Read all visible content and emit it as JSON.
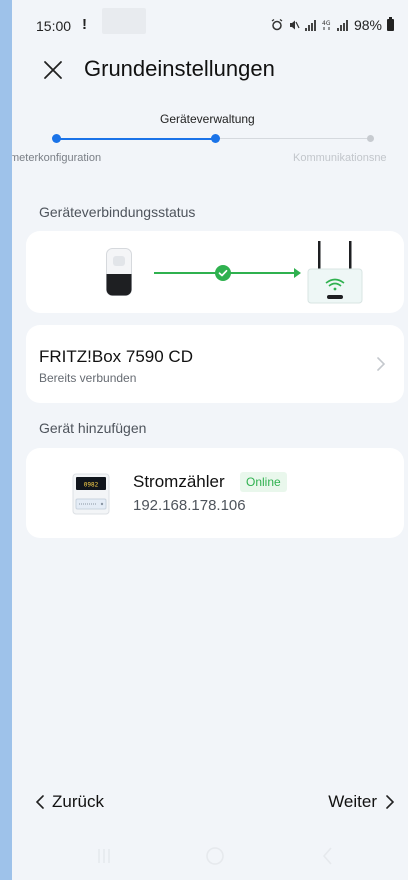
{
  "status_bar": {
    "time": "15:00",
    "alert": "!",
    "battery": "98%"
  },
  "header": {
    "title": "Grundeinstellungen"
  },
  "stepper": {
    "current": "Geräteverwaltung",
    "previous": "meterkonfiguration",
    "next": "Kommunikationsne"
  },
  "connection": {
    "section_title": "Geräteverbindungsstatus",
    "status_color": "#2fb14f"
  },
  "router": {
    "name": "FRITZ!Box 7590 CD",
    "subtitle": "Bereits verbunden"
  },
  "add_device": {
    "section_title": "Gerät hinzufügen",
    "device_name": "Stromzähler",
    "badge": "Online",
    "ip": "192.168.178.106"
  },
  "footer": {
    "back_label": "Zurück",
    "next_label": "Weiter"
  },
  "colors": {
    "accent": "#1a73e8",
    "online": "#2fb14f",
    "page_bg": "#f2f5f9"
  }
}
